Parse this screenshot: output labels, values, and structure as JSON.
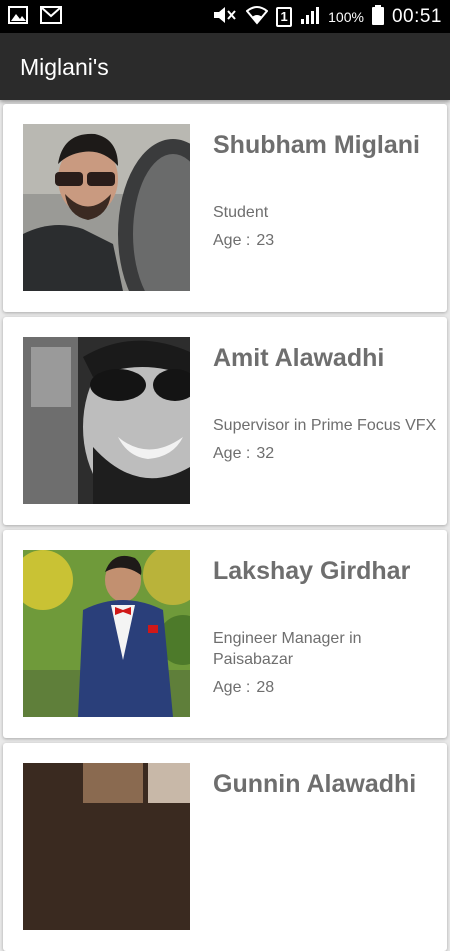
{
  "status_bar": {
    "battery": "100%",
    "time": "00:51",
    "sim": "1"
  },
  "app_bar": {
    "title": "Miglani's"
  },
  "age_label": "Age :",
  "people": [
    {
      "name": "Shubham Miglani",
      "occupation": "Student",
      "age": "23"
    },
    {
      "name": "Amit Alawadhi",
      "occupation": "Supervisor in Prime Focus VFX",
      "age": "32"
    },
    {
      "name": "Lakshay Girdhar",
      "occupation": "Engineer Manager in Paisabazar",
      "age": "28"
    },
    {
      "name": "Gunnin Alawadhi",
      "occupation": "",
      "age": ""
    }
  ]
}
